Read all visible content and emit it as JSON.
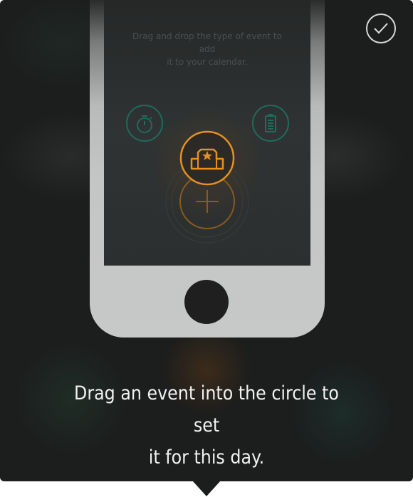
{
  "instruction": {
    "line1": "Drag an event into the circle to set",
    "line2": "it for this day."
  },
  "phone_screen": {
    "hint_line1": "Drag and drop the type of event to add",
    "hint_line2": "it to your calendar."
  },
  "colors": {
    "background": "#1c1d1d",
    "accent_orange": "#e8901e",
    "accent_teal": "#1f7a68",
    "phone_body": "#c7c8c8"
  },
  "icons": {
    "done": "checkmark-icon",
    "timer": "stopwatch-icon",
    "battery": "battery-icon",
    "event": "podium-icon",
    "add": "plus-icon"
  }
}
